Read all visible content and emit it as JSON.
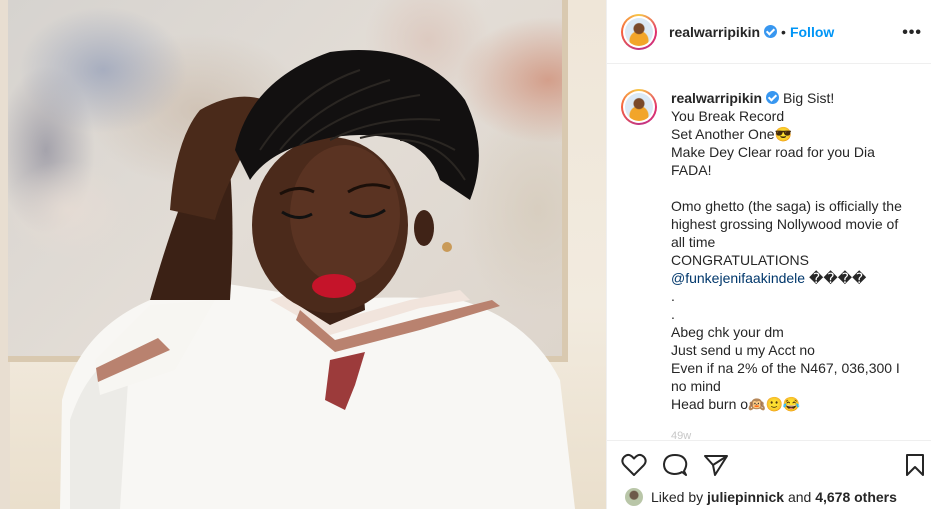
{
  "post": {
    "username": "realwarripikin",
    "follow_label": "Follow",
    "separator": "•",
    "more_label": "•••"
  },
  "caption": {
    "username": "realwarripikin",
    "lines": [
      "Big Sist!",
      "You Break Record",
      "Set Another One😎",
      "Make Dey Clear road for you Dia FADA!",
      "",
      "Omo ghetto (the saga) is officially the highest grossing Nollywood movie of all time",
      "CONGRATULATIONS"
    ],
    "mention": "@funkejenifaakindele",
    "mention_suffix": " ����",
    "lines_after": [
      ".",
      ".",
      "Abeg chk your dm",
      "Just send u my Acct no",
      "Even if na 2% of the N467, 036,300 I no mind",
      "Head burn o🙉🙂😂"
    ],
    "faded_text": "49w"
  },
  "actions": {
    "icons": [
      "heart-icon",
      "comment-icon",
      "share-icon",
      "bookmark-icon"
    ]
  },
  "likes": {
    "prefix": "Liked by",
    "user": "juliepinnick",
    "middle": "and",
    "count": "4,678 others"
  },
  "colors": {
    "follow": "#0095f6",
    "verified": "#3897f0",
    "text": "#262626",
    "border": "#efefef"
  }
}
